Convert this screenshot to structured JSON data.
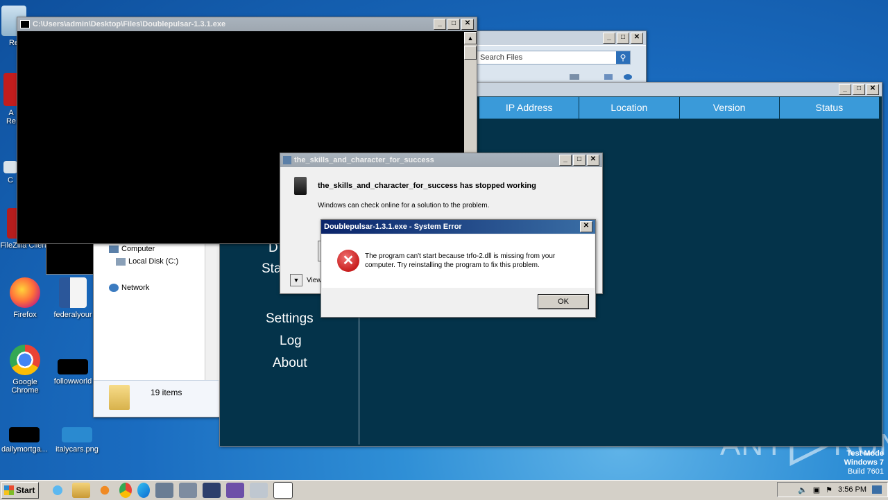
{
  "desktop": {
    "icons": [
      {
        "label": "Re"
      },
      {
        "label": "A\nRe"
      },
      {
        "label": "C"
      },
      {
        "label": "FileZilla Client"
      },
      {
        "label": "Firefox"
      },
      {
        "label": "federalyour"
      },
      {
        "label": "Google Chrome"
      },
      {
        "label": "followworld"
      },
      {
        "label": "dailymortga..."
      },
      {
        "label": "italycars.png"
      }
    ],
    "watermark": {
      "left": "ANY",
      "right": "RUN"
    },
    "test_mode": {
      "line1": "Test Mode",
      "line2": "Windows 7",
      "line3": "Build 7601"
    }
  },
  "cmd_window": {
    "title": "C:\\Users\\admin\\Desktop\\Files\\Doublepulsar-1.3.1.exe"
  },
  "explorer": {
    "search_placeholder": "Search Files",
    "nav": {
      "computer": "Computer",
      "local_disk": "Local Disk (C:)",
      "network": "Network"
    },
    "status_items": "19 items"
  },
  "app_window": {
    "columns": [
      "IP Address",
      "Location",
      "Version",
      "Status"
    ],
    "menu": {
      "partial1": "D",
      "partial2": "Sta",
      "settings": "Settings",
      "log": "Log",
      "about": "About"
    }
  },
  "stopped_dialog": {
    "title": "the_skills_and_character_for_success",
    "heading": "the_skills_and_character_for_success has stopped working",
    "message": "Windows can check online for a solution to the problem.",
    "view_label": "View"
  },
  "error_dialog": {
    "title": "Doublepulsar-1.3.1.exe - System Error",
    "message": "The program can't start because trfo-2.dll is missing from your computer. Try reinstalling the program to fix this problem.",
    "ok_label": "OK",
    "close_glyph": "✕"
  },
  "taskbar": {
    "start_label": "Start",
    "clock": "3:56 PM"
  },
  "colors": {
    "app_bg": "#04334a",
    "app_header": "#3a9ad9",
    "error_red": "#c81e1e"
  }
}
